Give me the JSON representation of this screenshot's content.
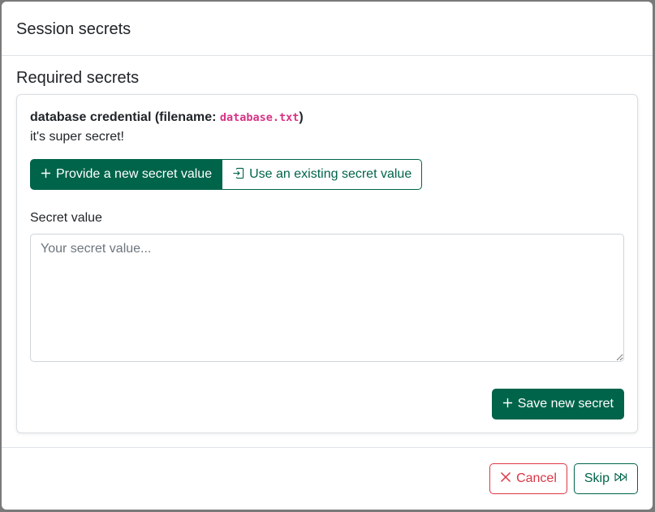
{
  "modal": {
    "title": "Session secrets",
    "section_title": "Required secrets"
  },
  "secret": {
    "name_prefix": "database credential (filename: ",
    "filename": "database.txt",
    "name_suffix": ")",
    "description": "it's super secret!"
  },
  "mode_buttons": {
    "new_label": "Provide a new secret value",
    "existing_label": "Use an existing secret value"
  },
  "form": {
    "value_label": "Secret value",
    "value_placeholder": "Your secret value...",
    "value": "",
    "save_label": "Save new secret"
  },
  "footer": {
    "cancel_label": "Cancel",
    "skip_label": "Skip"
  },
  "colors": {
    "primary": "#00644a",
    "danger": "#dc3545",
    "code": "#d63384"
  },
  "icons": [
    "plus-icon",
    "import-icon",
    "x-icon",
    "skip-forward-icon"
  ]
}
